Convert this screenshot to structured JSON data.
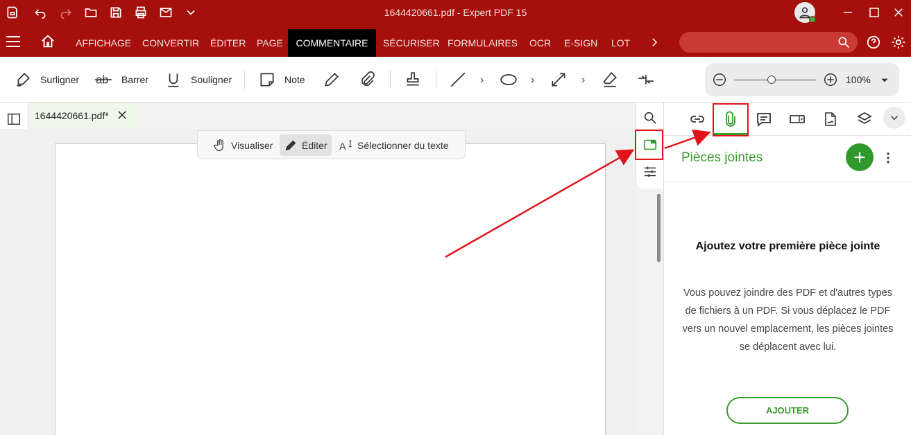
{
  "titlebar": {
    "doc_title": "1644420661.pdf  -  Expert PDF 15",
    "icons": [
      "app-logo-icon",
      "undo-icon",
      "redo-icon",
      "open-folder-icon",
      "save-icon",
      "print-icon",
      "email-icon",
      "chevron-down-icon"
    ]
  },
  "menubar": {
    "items": [
      "AFFICHAGE",
      "CONVERTIR",
      "ÉDITER",
      "PAGE",
      "COMMENTAIRE",
      "SÉCURISER",
      "FORMULAIRES",
      "OCR",
      "E-SIGN",
      "LOT"
    ],
    "active": "COMMENTAIRE",
    "search_placeholder": ""
  },
  "ribbon": {
    "highlight": "Surligner",
    "strike": "Barrer",
    "underline": "Souligner",
    "note": "Note",
    "zoom_value": "100%",
    "zoom_level_fraction": 0.46
  },
  "document_tab": {
    "label": "1644420661.pdf*"
  },
  "mode_bar": {
    "view": "Visualiser",
    "edit": "Éditer",
    "select_text": "Sélectionner du texte",
    "active": "Éditer"
  },
  "right_panel": {
    "title": "Pièces jointes",
    "heading": "Ajoutez votre première pièce jointe",
    "body": "Vous pouvez joindre des PDF et d'autres types de fichiers à un PDF. Si vous déplacez le PDF vers un nouvel emplacement, les pièces jointes se déplacent avec lui.",
    "button": "AJOUTER",
    "active_tab": "attachments"
  },
  "colors": {
    "brand_red": "#a5100c",
    "accent_green": "#3a9b2f",
    "annotation_red": "#e1141b"
  }
}
